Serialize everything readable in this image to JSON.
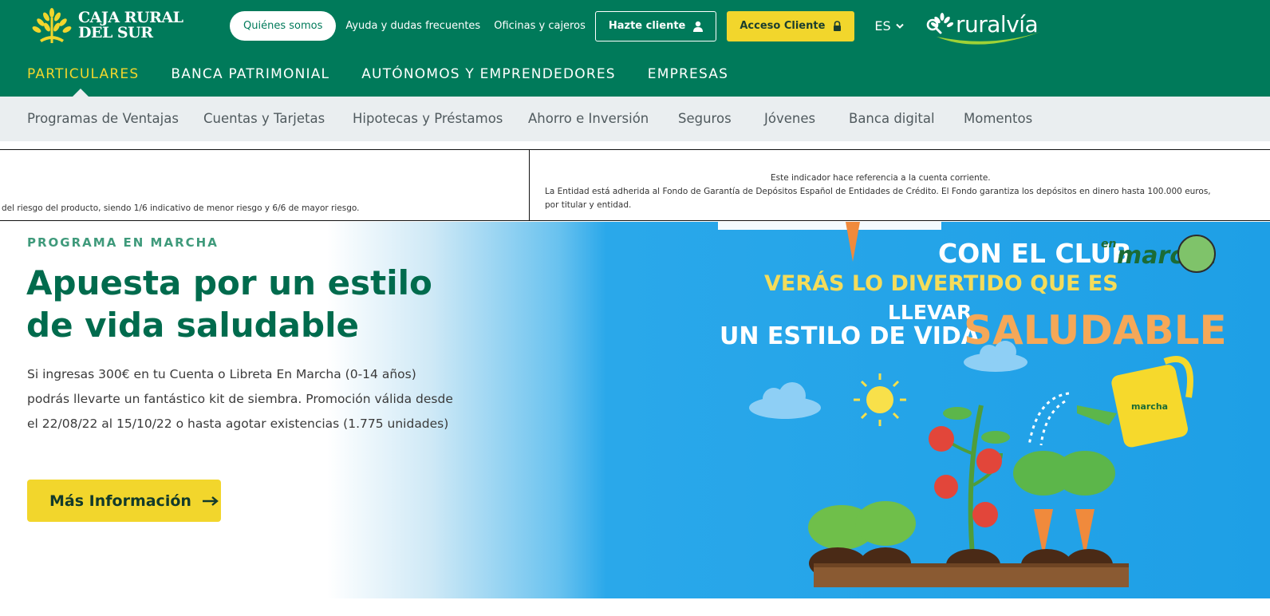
{
  "brand": {
    "logo_line1": "CAJA RURAL",
    "logo_line2": "DEL SUR",
    "online_brand": "ruralvía",
    "primary_color": "#007a5a",
    "accent_color": "#f2d62c"
  },
  "top_links": {
    "about": "Quiénes somos",
    "help": "Ayuda y dudas frecuentes",
    "offices": "Oficinas y cajeros",
    "become_client": "Hazte cliente",
    "client_access": "Acceso Cliente",
    "language": "ES"
  },
  "main_nav": [
    "PARTICULARES",
    "BANCA PATRIMONIAL",
    "AUTÓNOMOS Y EMPRENDEDORES",
    "EMPRESAS"
  ],
  "sub_nav": [
    "Programas de Ventajas",
    "Cuentas y Tarjetas",
    "Hipotecas y Préstamos",
    "Ahorro e Inversión",
    "Seguros",
    "Jóvenes",
    "Banca digital",
    "Momentos"
  ],
  "info_strip": {
    "left": "del riesgo del producto, siendo 1/6 indicativo de menor riesgo y 6/6 de mayor riesgo.",
    "center": "Este indicador hace referencia a la cuenta corriente.",
    "right": "La Entidad está adherida al Fondo de Garantía de Depósitos Español de Entidades de Crédito. El Fondo garantiza los depósitos en dinero hasta 100.000 euros, por titular y entidad."
  },
  "hero": {
    "label": "PROGRAMA EN MARCHA",
    "title_line1": "Apuesta por un estilo",
    "title_line2": "de vida saludable",
    "description": "Si ingresas 300€ en tu Cuenta o Libreta En Marcha (0-14 años) podrás llevarte un fantástico kit de siembra. Promoción válida desde el 22/08/22 al 15/10/22 o hasta agotar existencias (1.775 unidades)",
    "cta": "Más Información",
    "art": {
      "line1": "CON EL CLUB",
      "club_logo": "marcha",
      "club_logo_small": "en",
      "line2": "VERÁS LO DIVERTIDO QUE ES",
      "line3": "LLEVAR",
      "line4": "UN ESTILO DE VIDA",
      "line5": "SALUDABLE",
      "can_logo": "marcha"
    }
  }
}
